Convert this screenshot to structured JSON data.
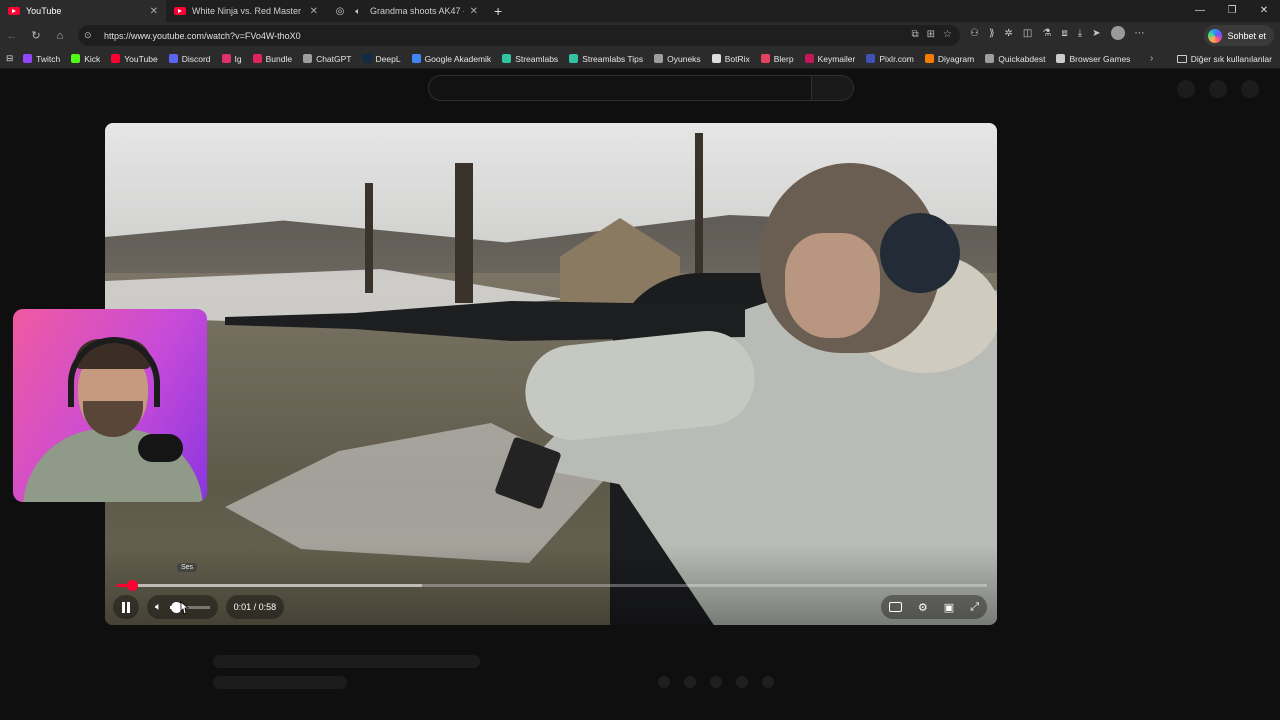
{
  "browser": {
    "tabs": [
      {
        "title": "YouTube",
        "favicon": "youtube-icon",
        "active": true
      },
      {
        "title": "White Ninja vs. Red Master - YouT",
        "favicon": "youtube-icon",
        "active": false
      },
      {
        "title": "Grandma shoots AK47 - You",
        "favicon": "globe-icon",
        "active": false
      }
    ],
    "url": "https://www.youtube.com/watch?v=FVo4W-thoX0",
    "copilot_label": "Sohbet et",
    "bookmarks": [
      {
        "label": "Twitch",
        "color": "#9146ff"
      },
      {
        "label": "Kick",
        "color": "#53fc18"
      },
      {
        "label": "YouTube",
        "color": "#ff0033"
      },
      {
        "label": "Discord",
        "color": "#5865f2"
      },
      {
        "label": "Ig",
        "color": "#e1306c"
      },
      {
        "label": "Bundle",
        "color": "#e0245e"
      },
      {
        "label": "ChatGPT",
        "color": "#9e9e9e"
      },
      {
        "label": "DeepL",
        "color": "#0f2b46"
      },
      {
        "label": "Google Akademik",
        "color": "#4285f4"
      },
      {
        "label": "Streamlabs",
        "color": "#31c3a2"
      },
      {
        "label": "Streamlabs Tips",
        "color": "#31c3a2"
      },
      {
        "label": "Oyuneks",
        "color": "#9e9e9e"
      },
      {
        "label": "BotRix",
        "color": "#dddddd"
      },
      {
        "label": "Blerp",
        "color": "#e4405f"
      },
      {
        "label": "Keymailer",
        "color": "#c2185b"
      },
      {
        "label": "Pixlr.com",
        "color": "#3f51b5"
      },
      {
        "label": "Diyagram",
        "color": "#f57c00"
      },
      {
        "label": "Quickabdest",
        "color": "#9e9e9e"
      },
      {
        "label": "Browser Games",
        "color": "#cccccc"
      }
    ],
    "other_bookmarks_label": "Diğer sık kullanılanlar"
  },
  "player": {
    "time_label": "0:01 / 0:58",
    "progress_fraction": 0.017,
    "buffer_fraction": 0.35,
    "volume_fraction": 0.15,
    "tooltip": "Ses",
    "accent_color": "#ff0033"
  }
}
